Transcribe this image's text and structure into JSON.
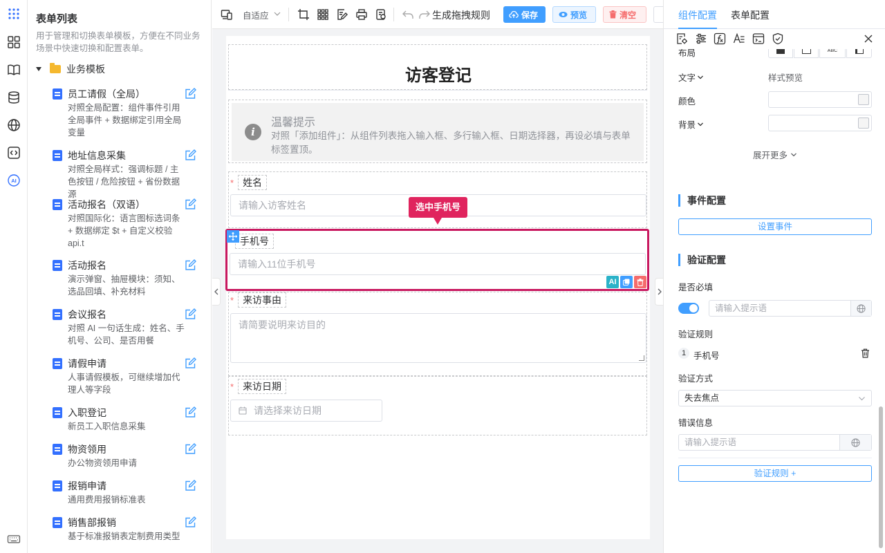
{
  "rail": {
    "icons": [
      "apps-grid-icon",
      "components-icon",
      "book-icon",
      "database-icon",
      "globe-icon",
      "code-icon",
      "ai-icon",
      "keyboard-icon"
    ]
  },
  "left_panel": {
    "title": "表单列表",
    "description": "用于管理和切换表单模板，方便在不同业务场景中快速切换和配置表单。",
    "folder": "业务模板",
    "templates": [
      {
        "name": "员工请假（全局）",
        "desc": "对照全局配置：组件事件引用全局事件 + 数据绑定引用全局变量"
      },
      {
        "name": "地址信息采集",
        "desc": "对照全局样式：强调标题 / 主色按钮 / 危险按钮 + 省份数据源"
      },
      {
        "name": "活动报名（双语）",
        "desc": "对照国际化：语言图标选词条 + 数据绑定 $t + 自定义校验 api.t"
      },
      {
        "name": "活动报名",
        "desc": "演示弹窗、抽屉模块：须知、选品回填、补充材料"
      },
      {
        "name": "会议报名",
        "desc": "对照 AI 一句话生成：姓名、手机号、公司、是否用餐"
      },
      {
        "name": "请假申请",
        "desc": "人事请假模板，可继续增加代理人等字段"
      },
      {
        "name": "入职登记",
        "desc": "新员工入职信息采集"
      },
      {
        "name": "物资领用",
        "desc": "办公物资领用申请"
      },
      {
        "name": "报销申请",
        "desc": "通用费用报销标准表"
      },
      {
        "name": "销售部报销",
        "desc": "基于标准报销表定制费用类型"
      }
    ]
  },
  "toolbar": {
    "layout_mode": "自适应",
    "generate_rule": "生成拖拽规则",
    "save": "保存",
    "preview": "预览",
    "clear": "清空"
  },
  "canvas": {
    "form_title": "访客登记",
    "notice_title": "温馨提示",
    "notice_text": "对照「添加组件」：从组件列表拖入输入框、多行输入框、日期选择器，再设必填与表单标签置顶。",
    "fields": [
      {
        "label": "姓名",
        "required": true,
        "placeholder": "请输入访客姓名"
      },
      {
        "label": "手机号",
        "required": false,
        "placeholder": "请输入11位手机号"
      },
      {
        "label": "来访事由",
        "required": true,
        "placeholder": "请简要说明来访目的"
      },
      {
        "label": "来访日期",
        "required": true,
        "placeholder": "请选择来访日期"
      }
    ],
    "selected_tip": "选中手机号",
    "ai_label": "AI",
    "required_mark": "*"
  },
  "right_panel": {
    "tabs": [
      "组件配置",
      "表单配置"
    ],
    "active_tab": 0,
    "layout_label": "布局",
    "layout_options": [
      "ABC"
    ],
    "text_label": "文字",
    "text_value": "样式预览",
    "color_label": "颜色",
    "bg_label": "背景",
    "expand_more": "展开更多",
    "event_section": "事件配置",
    "set_event": "设置事件",
    "validation_section": "验证配置",
    "required_label": "是否必填",
    "required_placeholder": "请输入提示语",
    "rules_label": "验证规则",
    "rule_index": "1",
    "rule_name": "手机号",
    "method_label": "验证方式",
    "method_value": "失去焦点",
    "error_label": "错误信息",
    "error_placeholder": "请输入提示语",
    "add_rule": "验证规则 +"
  },
  "colors": {
    "primary": "#409eff",
    "danger": "#f56c6c",
    "selected_border": "#c8185f",
    "tip_bg": "#e0245e"
  }
}
